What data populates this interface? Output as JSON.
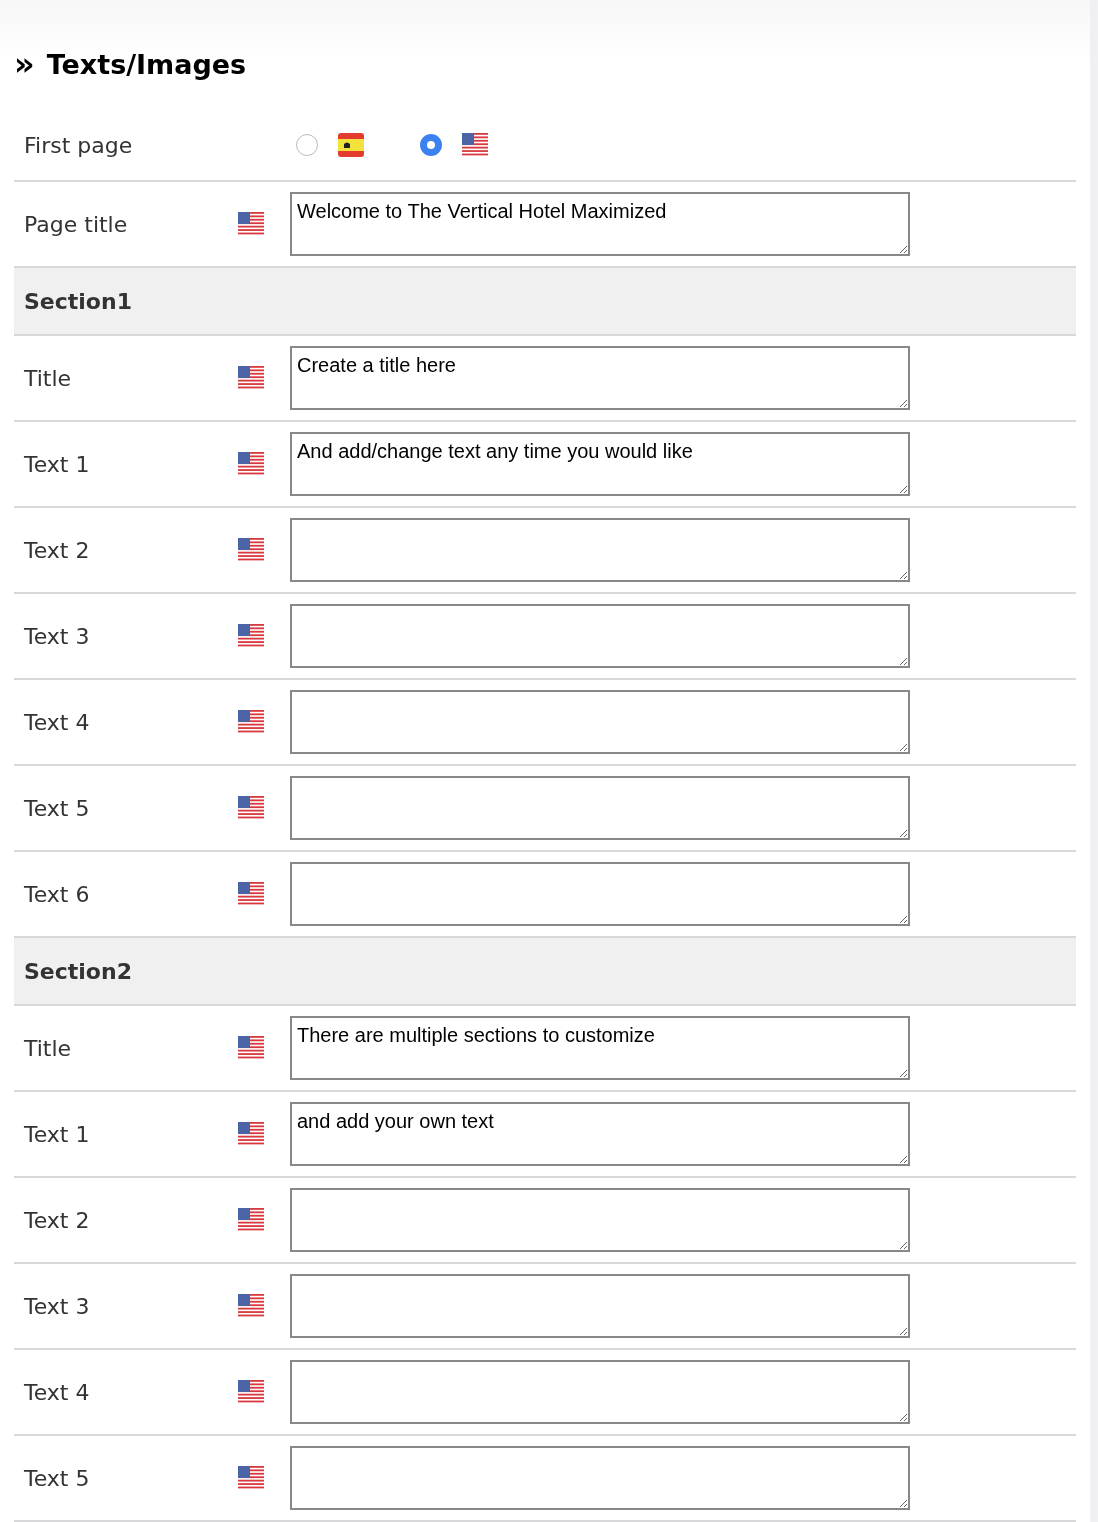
{
  "heading": {
    "icon": "»",
    "title": "Texts/Images"
  },
  "first_page": {
    "label": "First page",
    "languages": [
      {
        "kind": "es",
        "selected": false
      },
      {
        "kind": "us",
        "selected": true
      }
    ]
  },
  "page_title": {
    "label": "Page title",
    "kind": "us",
    "value": "Welcome to The Vertical Hotel Maximized"
  },
  "sections": [
    {
      "title": "Section1",
      "fields": [
        {
          "label": "Title",
          "kind": "us",
          "value": "Create a title here"
        },
        {
          "label": "Text 1",
          "kind": "us",
          "value": "And add/change text any time you would like"
        },
        {
          "label": "Text 2",
          "kind": "us"
        },
        {
          "label": "Text 3",
          "kind": "us"
        },
        {
          "label": "Text 4",
          "kind": "us"
        },
        {
          "label": "Text 5",
          "kind": "us"
        },
        {
          "label": "Text 6",
          "kind": "us"
        }
      ]
    },
    {
      "title": "Section2",
      "fields": [
        {
          "label": "Title",
          "kind": "us",
          "value": "There are multiple sections to customize"
        },
        {
          "label": "Text 1",
          "kind": "us",
          "value": "and add your own text"
        },
        {
          "label": "Text 2",
          "kind": "us"
        },
        {
          "label": "Text 3",
          "kind": "us"
        },
        {
          "label": "Text 4",
          "kind": "us"
        },
        {
          "label": "Text 5",
          "kind": "us"
        }
      ]
    }
  ]
}
